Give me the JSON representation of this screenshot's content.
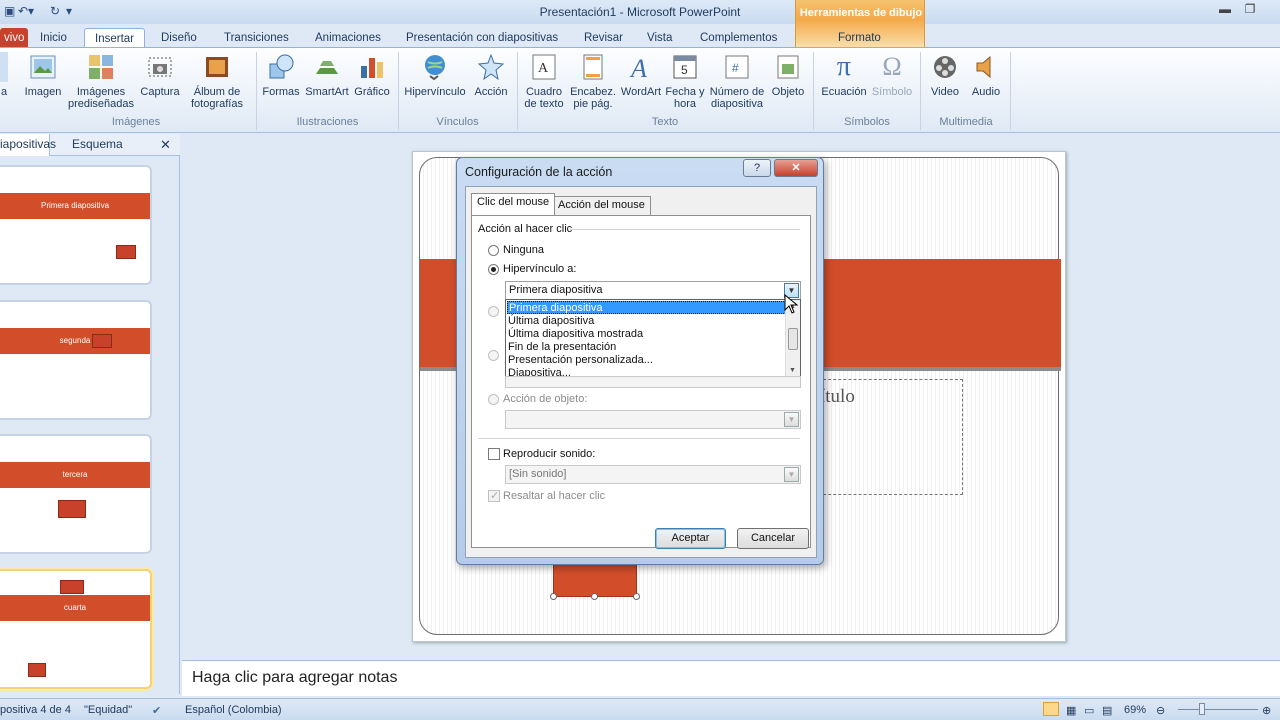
{
  "window": {
    "title": "Presentación1 - Microsoft PowerPoint",
    "context_tool": "Herramientas de dibujo"
  },
  "tabs": [
    "vivo",
    "Inicio",
    "Insertar",
    "Diseño",
    "Transiciones",
    "Animaciones",
    "Presentación con diapositivas",
    "Revisar",
    "Vista",
    "Complementos",
    "Formato"
  ],
  "ribbon": {
    "buttons": {
      "tabla": "a",
      "imagen": "Imagen",
      "imagenes_pred": "Imágenes prediseñadas",
      "captura": "Captura",
      "album": "Álbum de fotografías",
      "formas": "Formas",
      "smartart": "SmartArt",
      "grafico": "Gráfico",
      "hipervinculo": "Hipervínculo",
      "accion": "Acción",
      "cuadro_texto": "Cuadro de texto",
      "encabez": "Encabez. pie pág.",
      "wordart": "WordArt",
      "fecha": "Fecha y hora",
      "numero": "Número de diapositiva",
      "objeto": "Objeto",
      "ecuacion": "Ecuación",
      "simbolo": "Símbolo",
      "video": "Video",
      "audio": "Audio"
    },
    "groups": {
      "imagenes": "Imágenes",
      "ilustraciones": "Ilustraciones",
      "vinculos": "Vínculos",
      "texto": "Texto",
      "simbolos": "Símbolos",
      "multimedia": "Multimedia"
    }
  },
  "left_panel": {
    "tab_slides": "iapositivas",
    "tab_outline": "Esquema",
    "thumbs": [
      "Primera diapositiva",
      "segunda",
      "tercera",
      "cuarta"
    ]
  },
  "slide": {
    "subtitle_fragment": "ítulo"
  },
  "notes": "Haga clic para agregar notas",
  "status": {
    "slide": "positiva 4 de 4",
    "theme": "\"Equidad\"",
    "language": "Español (Colombia)",
    "zoom": "69%"
  },
  "dialog": {
    "title": "Configuración de la acción",
    "help": "?",
    "close": "✕",
    "tab_click": "Clic del mouse",
    "tab_hover": "Acción del mouse",
    "section": "Acción al hacer clic",
    "opt_none": "Ninguna",
    "opt_link": "Hipervínculo a:",
    "link_value": "Primera diapositiva",
    "dropdown_items": [
      "Primera diapositiva",
      "Última diapositiva",
      "Última diapositiva mostrada",
      "Fin de la presentación",
      "Presentación personalizada...",
      "Diapositiva..."
    ],
    "opt_object": "Acción de objeto:",
    "sound_label": "Reproducir sonido:",
    "sound_value": "[Sin sonido]",
    "highlight": "Resaltar al hacer clic",
    "ok": "Aceptar",
    "cancel": "Cancelar"
  }
}
